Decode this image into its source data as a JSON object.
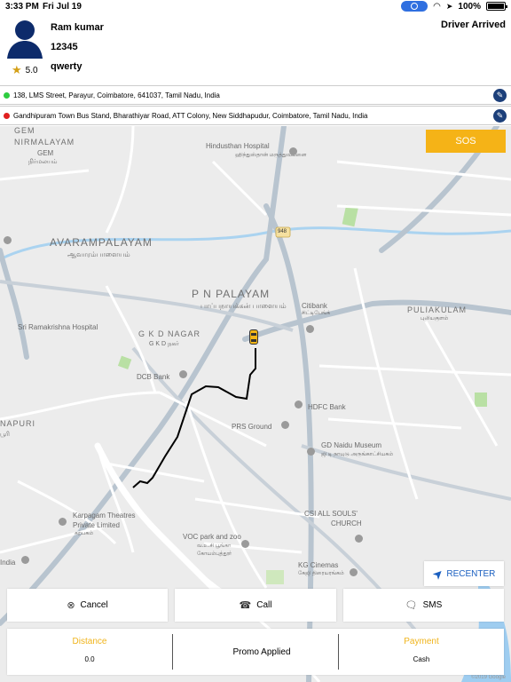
{
  "status_bar": {
    "time": "3:33 PM",
    "date": "Fri Jul 19",
    "battery": "100%"
  },
  "driver": {
    "name": "Ram  kumar",
    "id": "12345",
    "vehicle": "qwerty",
    "rating": "5.0"
  },
  "trip_status": "Driver  Arrived",
  "pickup": {
    "address": "138, LMS Street, Parayur, Coimbatore, 641037, Tamil Nadu, India",
    "dot_color": "#2ecc40"
  },
  "dropoff": {
    "address": "Gandhipuram Town Bus Stand, Bharathiyar Road, ATT Colony, New Siddhapudur, Coimbatore, Tamil Nadu, India",
    "dot_color": "#e02020"
  },
  "sos_label": "SOS",
  "recenter_label": "RECENTER",
  "actions": {
    "cancel": "Cancel",
    "call": "Call",
    "sms": "SMS"
  },
  "info": {
    "distance_label": "Distance",
    "distance_value": "0.0",
    "promo": "Promo  Applied",
    "payment_label": "Payment",
    "payment_value": "Cash"
  },
  "map": {
    "labels": {
      "gem": "GEM",
      "nirmalayam": "NIRMALAYAM",
      "gem_ta": "GEM",
      "nirmalayam_ta": "நிர்மலயம்",
      "hindusthan": "Hindusthan Hospital",
      "hindusthan_ta": "ஹிந்துஸ்தான் மருத்துவமனை",
      "avarampalayam": "AVARAMPALAYAM",
      "avarampalayam_ta": "ஆவாரம்பாளையம்",
      "road_948": "948",
      "pn_palayam": "P N PALAYAM",
      "pn_palayam_ta": "பாப்பநாயக்கன் பாளையம்",
      "citibank": "Citibank",
      "citibank_ta": "சிட்டிபேங்க்",
      "puliakulam": "PULIAKULAM",
      "puliakulam_ta": "புலியகுளம்",
      "sri_ramakrishna": "Sri Ramakrishna Hospital",
      "gkd_nagar": "G K D NAGAR",
      "gkd_nagar_ta": "G K D நகர்",
      "dcb_bank": "DCB Bank",
      "hdfc_bank": "HDFC Bank",
      "prs_ground": "PRS Ground",
      "gd_naidu": "GD Naidu Museum",
      "gd_naidu_ta": "ஜி டி நாயுடு அருங்காட்சியகம்",
      "napuri": "NAPURI",
      "napuri_ta": "பூரி",
      "karpagam": "Karpagam Theatres",
      "karpagam2": "Private Limited",
      "karpagam_ta": "கற்பகம்",
      "csi": "CSI ALL SOULS'",
      "csi2": "CHURCH",
      "voc": "VOC park and zoo",
      "voc_ta": "வ.உ.சி பூங்கா",
      "voc_ta2": "கோயம்புத்தூர்",
      "india": "India",
      "kg_cinemas": "KG Cinemas",
      "kg_cinemas_ta": "கேஜி திரையரங்கம்",
      "google": "©2019 Google"
    }
  }
}
